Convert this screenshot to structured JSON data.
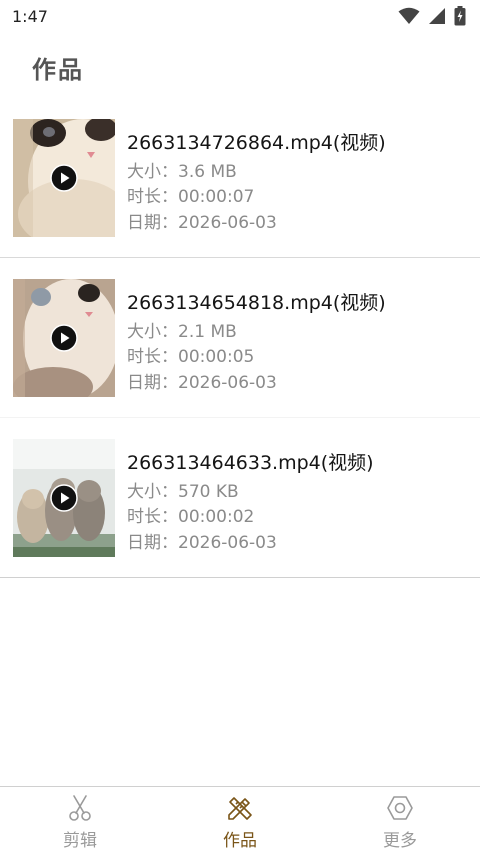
{
  "status_bar": {
    "time": "1:47",
    "icons": [
      "wifi-icon",
      "signal-icon",
      "battery-icon"
    ]
  },
  "header": {
    "title": "作品"
  },
  "works": [
    {
      "name": "2663134726864.mp4(视频)",
      "size": "大小：3.6 MB",
      "duration": "时长：00:00:07",
      "date": "日期：2026-06-03",
      "thumbnail": "kitten-closeup"
    },
    {
      "name": "2663134654818.mp4(视频)",
      "size": "大小：2.1 MB",
      "duration": "时长：00:00:05",
      "date": "日期：2026-06-03",
      "thumbnail": "kitten-face"
    },
    {
      "name": "266313464633.mp4(视频)",
      "size": "大小：570 KB",
      "duration": "时长：00:00:02",
      "date": "日期：2026-06-03",
      "thumbnail": "kittens-group"
    }
  ],
  "bottom_nav": {
    "tabs": [
      {
        "label": "剪辑",
        "icon": "scissors-icon",
        "active": false
      },
      {
        "label": "作品",
        "icon": "pencil-ruler-icon",
        "active": true
      },
      {
        "label": "更多",
        "icon": "hexagon-settings-icon",
        "active": false
      }
    ]
  },
  "colors": {
    "active_tab": "#7a5518",
    "inactive_tab": "#9a9a9a",
    "meta_text": "#8a8a8a",
    "divider": "#d9d9d9"
  }
}
